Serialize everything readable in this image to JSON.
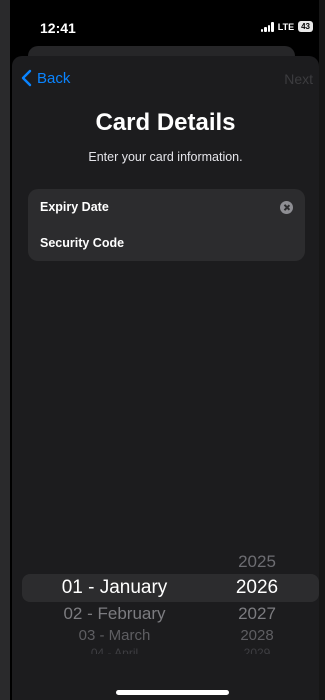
{
  "status_bar": {
    "time": "12:41",
    "network": "LTE",
    "battery": "43"
  },
  "nav": {
    "back_label": "Back",
    "next_label": "Next"
  },
  "header": {
    "title": "Card Details",
    "subtitle": "Enter your card information."
  },
  "form": {
    "fields": [
      {
        "label": "Expiry Date"
      },
      {
        "label": "Security Code"
      }
    ]
  },
  "picker": {
    "months": {
      "selected": "01 - January",
      "below": [
        "02 - February",
        "03 - March",
        "04 - April"
      ]
    },
    "years": {
      "above": "2025",
      "selected": "2026",
      "below": [
        "2027",
        "2028",
        "2029"
      ]
    }
  },
  "colors": {
    "accent": "#0a84ff",
    "sheet_background": "#1c1c1e",
    "field_background": "#2c2c2e"
  }
}
